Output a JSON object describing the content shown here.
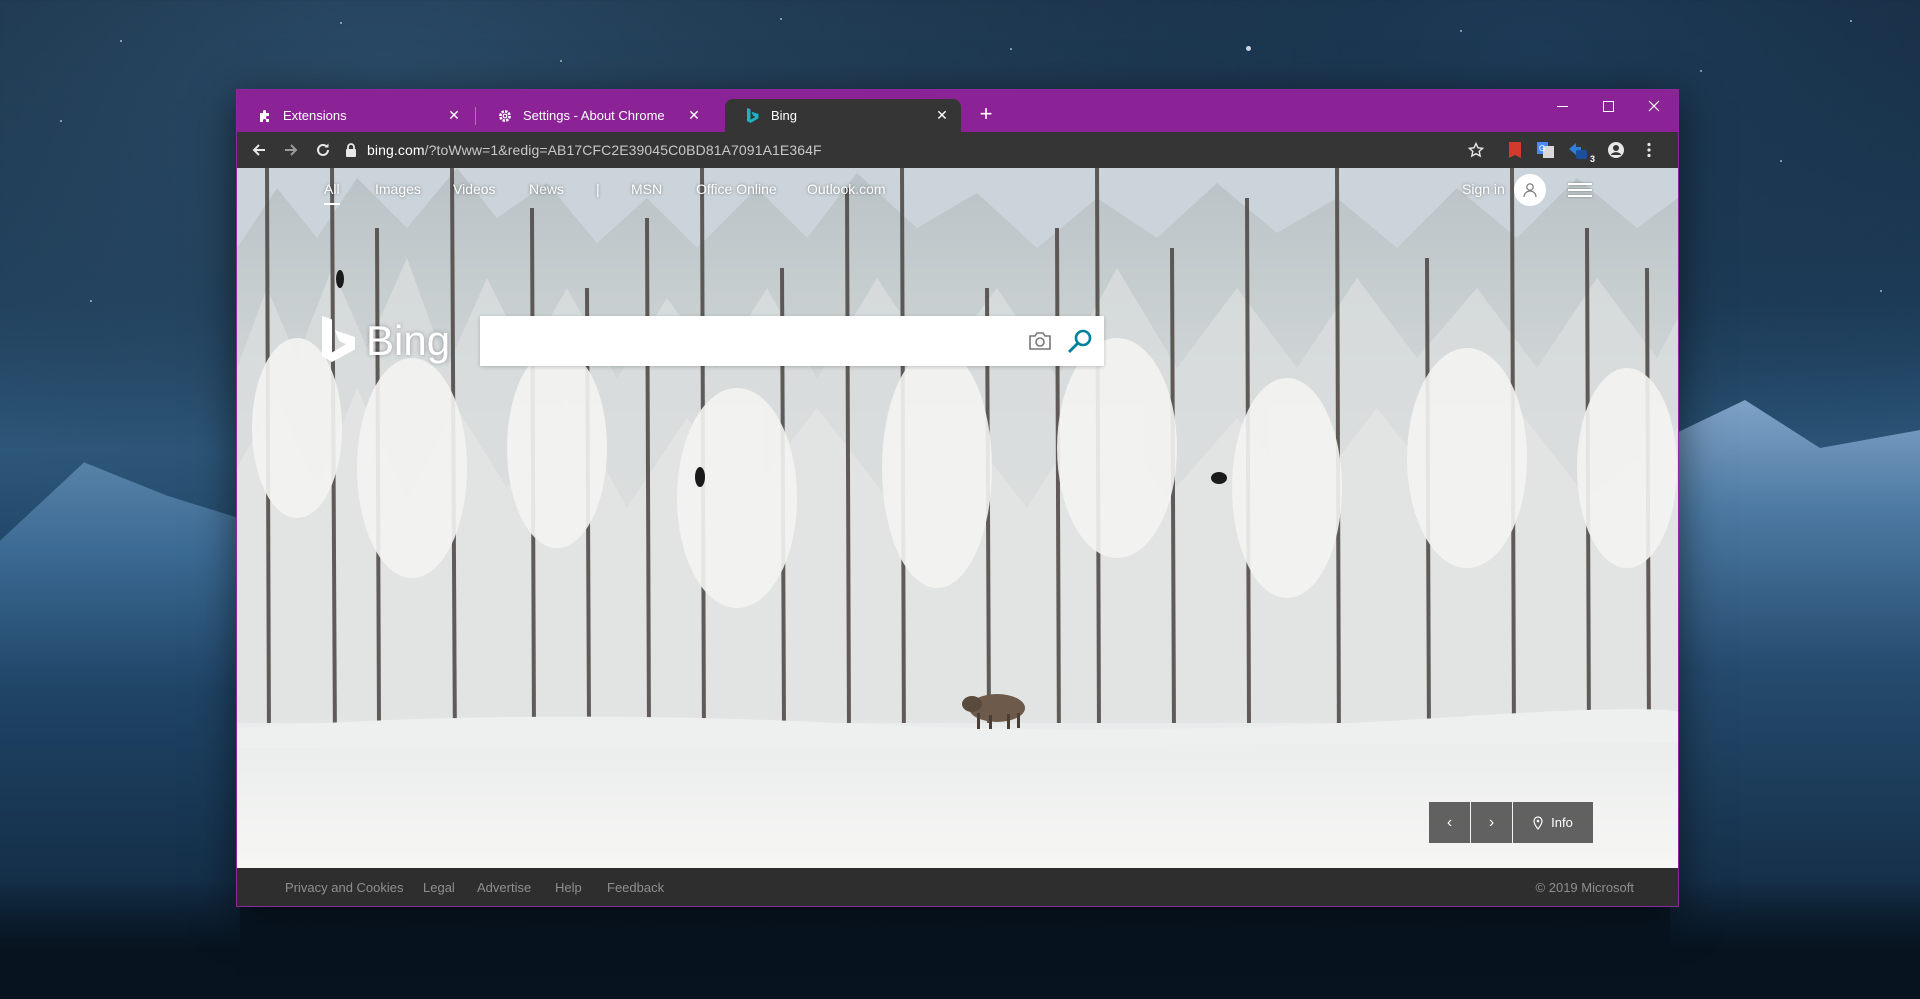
{
  "window": {
    "tabs": [
      {
        "title": "Extensions",
        "icon": "puzzle-icon"
      },
      {
        "title": "Settings - About Chrome",
        "icon": "gear-icon"
      },
      {
        "title": "Bing",
        "icon": "bing-icon"
      }
    ],
    "active_tab": 2,
    "frame_color": "#8b2396",
    "controls": {
      "minimize": "—",
      "maximize": "☐",
      "close": "✕"
    }
  },
  "toolbar": {
    "url_host": "bing.com",
    "url_path": "/?toWww=1&redig=AB17CFC2E39045C0BD81A7091A1E364F",
    "extension_badge": "3"
  },
  "bing": {
    "nav": [
      "All",
      "Images",
      "Videos",
      "News",
      "|",
      "MSN",
      "Office Online",
      "Outlook.com"
    ],
    "sign_in": "Sign in",
    "logo_text": "Bing",
    "search_placeholder": "",
    "carousel": {
      "prev": "‹",
      "next": "›",
      "info": "Info"
    },
    "footer_links": [
      "Privacy and Cookies",
      "Legal",
      "Advertise",
      "Help",
      "Feedback"
    ],
    "copyright": "© 2019 Microsoft"
  }
}
